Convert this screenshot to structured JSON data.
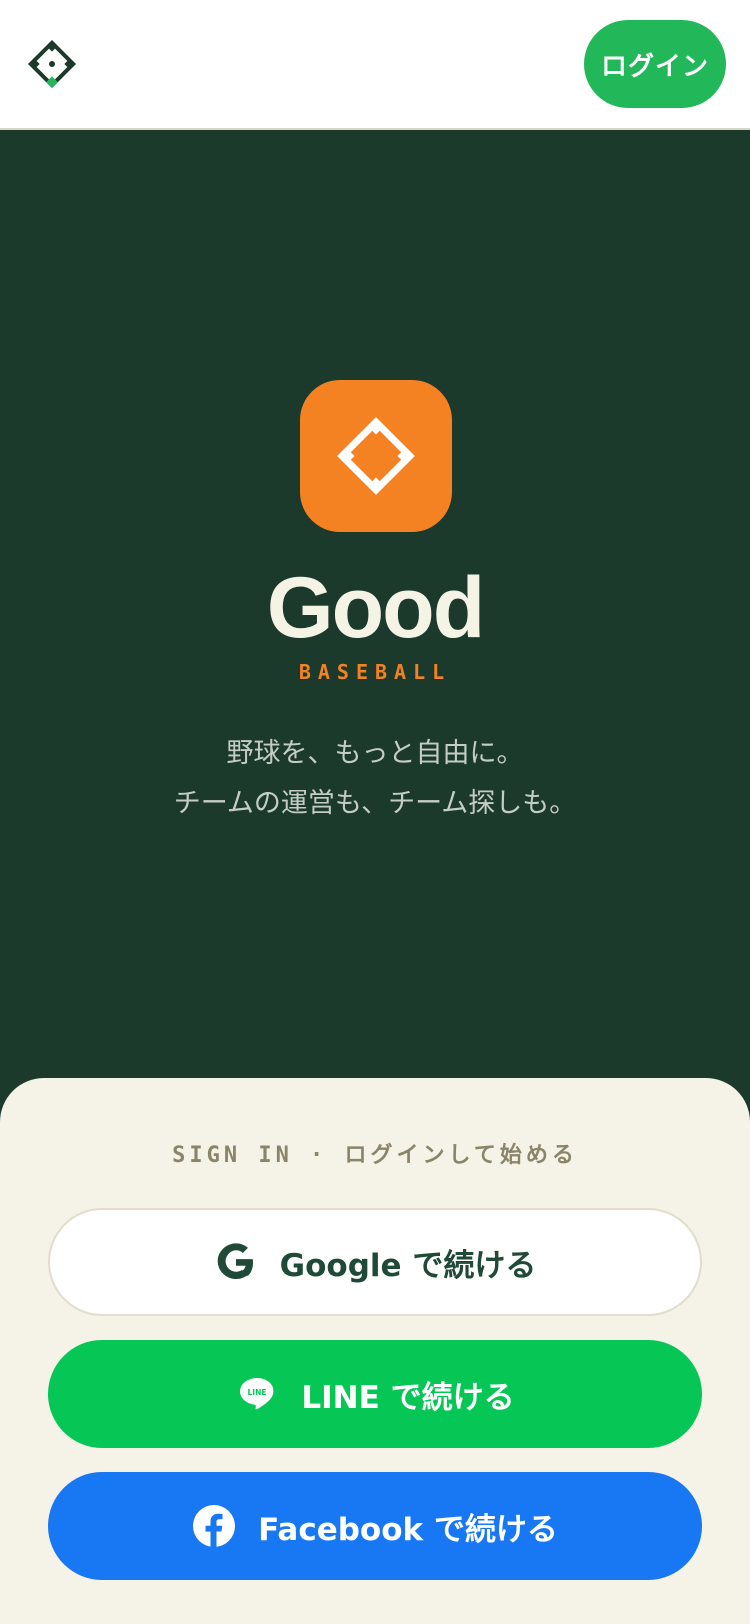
{
  "header": {
    "logo_icon": "baseball-diamond-icon",
    "login_label": "ログイン"
  },
  "hero": {
    "app_icon": "baseball-diamond-icon",
    "brand_name": "Good",
    "brand_sub": "BASEBALL",
    "tagline_line1": "野球を、もっと自由に。",
    "tagline_line2": "チームの運営も、チーム探しも。"
  },
  "signin": {
    "caption": "SIGN IN · ログインして始める",
    "buttons": [
      {
        "provider": "Google",
        "icon": "google-icon",
        "label": "Google で続ける"
      },
      {
        "provider": "LINE",
        "icon": "line-icon",
        "label": "LINE で続ける"
      },
      {
        "provider": "Facebook",
        "icon": "facebook-icon",
        "label": "Facebook で続ける"
      }
    ]
  },
  "colors": {
    "header_bg": "#ffffff",
    "hero_bg": "#1b3a2c",
    "accent_orange": "#f48223",
    "login_green": "#22b85a",
    "sheet_bg": "#f5f2e8",
    "google_text": "#1f4a37",
    "line_green": "#06c755",
    "facebook_blue": "#1877f2"
  }
}
